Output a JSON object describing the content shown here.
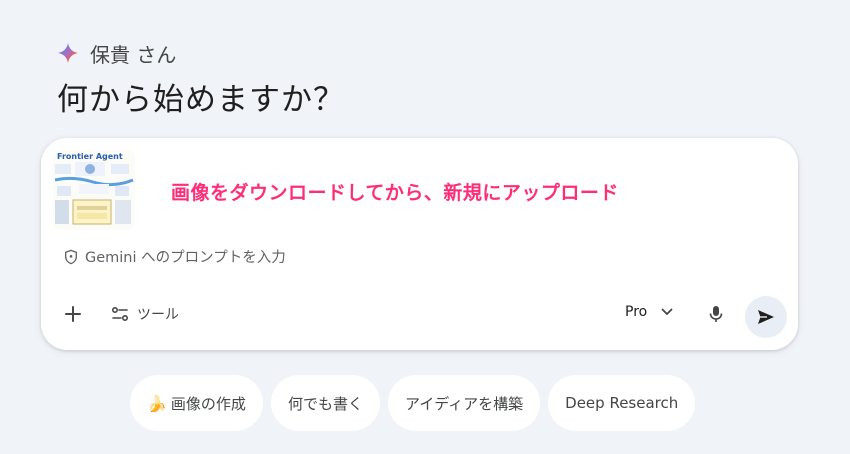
{
  "greeting": {
    "user_name": "保貴 さん",
    "headline": "何から始めますか？"
  },
  "attachment": {
    "thumbnail_title": "Frontier Agent"
  },
  "annotation": "画像をダウンロードしてから、新規にアップロード",
  "prompt": {
    "placeholder": "Gemini へのプロンプトを入力"
  },
  "toolbar": {
    "tools_label": "ツール",
    "model_label": "Pro"
  },
  "chips": [
    {
      "emoji": "🍌",
      "label": "画像の作成"
    },
    {
      "label": "何でも書く"
    },
    {
      "label": "アイディアを構築"
    },
    {
      "label": "Deep Research"
    }
  ],
  "colors": {
    "background": "#f0f3f8",
    "annotation": "#ff2d78",
    "send_button_bg": "#e9eef6"
  },
  "icons": [
    "gemini-sparkle-icon",
    "shield-icon",
    "plus-icon",
    "tools-icon",
    "chevron-down-icon",
    "mic-icon",
    "send-icon"
  ]
}
